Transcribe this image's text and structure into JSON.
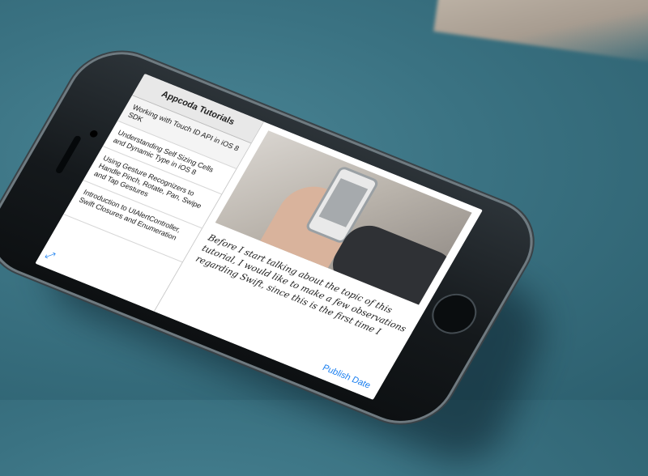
{
  "sidebar": {
    "title": "Appcoda Tutorials",
    "items": [
      {
        "label": "Working with Touch ID API in iOS 8 SDK"
      },
      {
        "label": "Understanding Self Sizing Cells and Dynamic Type in iOS 8"
      },
      {
        "label": "Using Gesture Recognizers to Handle Pinch, Rotate, Pan, Swipe and Tap Gestures"
      },
      {
        "label": "Introduction to UIAlertController, Swift Closures and Enumeration"
      }
    ],
    "expand_icon": "expand-arrows-icon"
  },
  "detail": {
    "article_text": "Before I start talking about the topic of this tutorial, I would like to make a few observations regarding Swift, since this is the first time I",
    "publish_label": "Publish Date"
  },
  "colors": {
    "accent": "#1a7ff0",
    "background": "#3a7282"
  }
}
